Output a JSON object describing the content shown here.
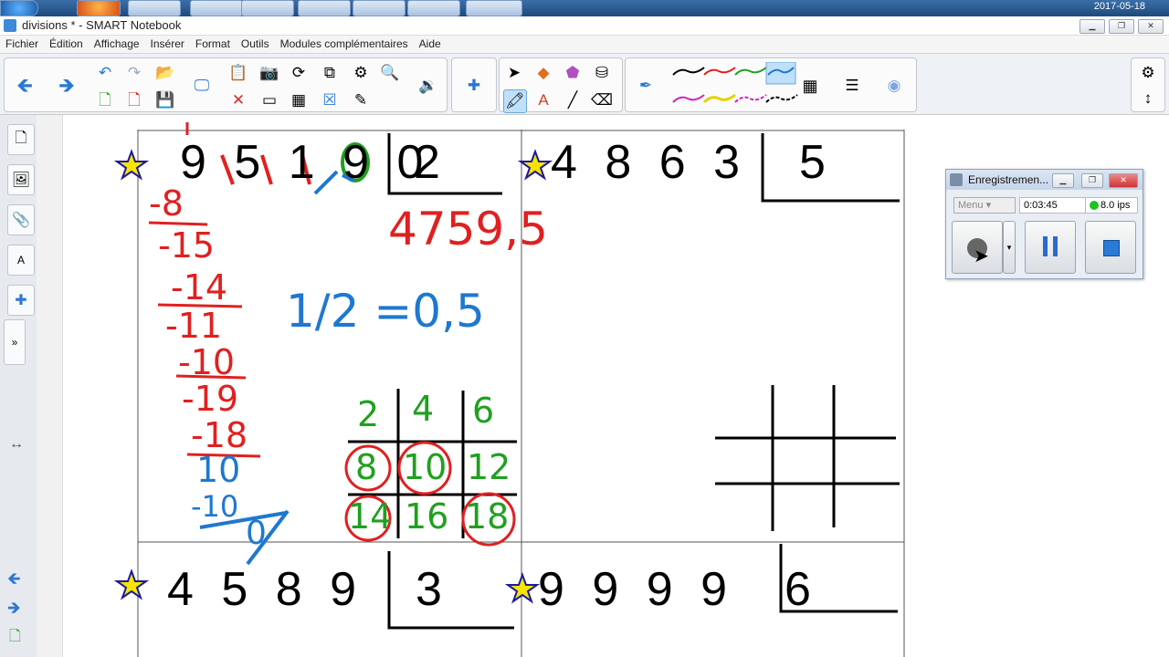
{
  "taskbar": {
    "date": "2017-05-18"
  },
  "window": {
    "title": "divisions * - SMART Notebook"
  },
  "menu": [
    "Fichier",
    "Édition",
    "Affichage",
    "Insérer",
    "Format",
    "Outils",
    "Modules complémentaires",
    "Aide"
  ],
  "toolbar": {
    "icons": [
      "back-arrow",
      "forward-arrow",
      "undo",
      "redo",
      "open-file",
      "new-page",
      "delete-page",
      "save",
      "screen-shade",
      "paste",
      "screen-capture",
      "rotate",
      "duplicate",
      "properties",
      "clear",
      "insert-table",
      "zoom",
      "document-camera",
      "sound",
      "add-ons",
      "select",
      "shapes",
      "eraser",
      "magic-pen",
      "text",
      "line",
      "fill",
      "pen",
      "color-palette",
      "settings",
      "move-toolbar"
    ],
    "colors": {
      "black": "#000000",
      "red": "#e02020",
      "green": "#20a020",
      "blue": "#1e78d0",
      "magenta": "#d020c0",
      "yellow": "#e8d000",
      "accent": "#3e7bd6"
    }
  },
  "canvas": {
    "problems": [
      {
        "dividend": "9 5 1 9 0",
        "divisor": "2"
      },
      {
        "dividend": "4 8 6 3",
        "divisor": "5"
      },
      {
        "dividend": "4 5 8 9",
        "divisor": "3"
      },
      {
        "dividend": "9 9 9 9",
        "divisor": "6"
      }
    ],
    "handwriting": {
      "quotient": "4759,5",
      "fraction": "1/2 =0,5",
      "steps": [
        "-8",
        "-15",
        "-14",
        "-11",
        "-10",
        "-19",
        "-18",
        "10",
        "-10",
        "0"
      ],
      "table": [
        [
          "2",
          "4",
          "6"
        ],
        [
          "8",
          "10",
          "12"
        ],
        [
          "14",
          "16",
          "18"
        ]
      ]
    }
  },
  "recorder": {
    "title": "Enregistremen...",
    "menu_label": "Menu",
    "time": "0:03:45",
    "fps": "8.0 ips"
  }
}
